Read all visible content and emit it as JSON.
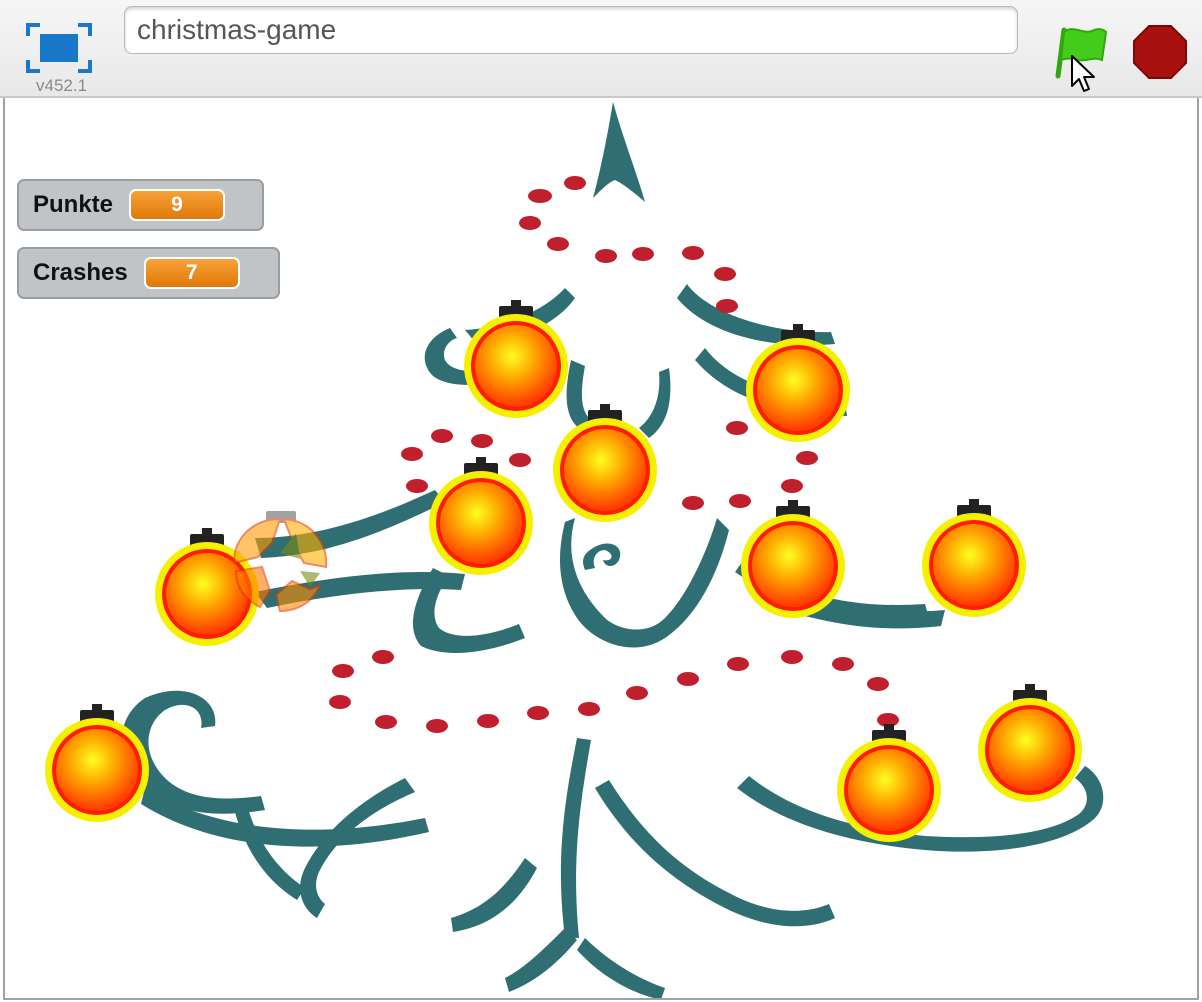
{
  "toolbar": {
    "project_title": "christmas-game",
    "version": "v452.1",
    "fullscreen_icon": "fullscreen-icon",
    "start_icon": "green-flag-icon",
    "stop_icon": "stop-sign-icon"
  },
  "monitors": [
    {
      "label": "Punkte",
      "value": "9"
    },
    {
      "label": "Crashes",
      "value": "7"
    }
  ],
  "colors": {
    "tree": "#2f6e72",
    "garland": "#c0202e",
    "ornament_rim": "#f5f000",
    "ornament_fill": "#ff8c00",
    "monitor_value": "#e98a1a",
    "flag": "#44cc1a",
    "stop": "#a8100e",
    "fullscreen": "#1a78c8"
  }
}
